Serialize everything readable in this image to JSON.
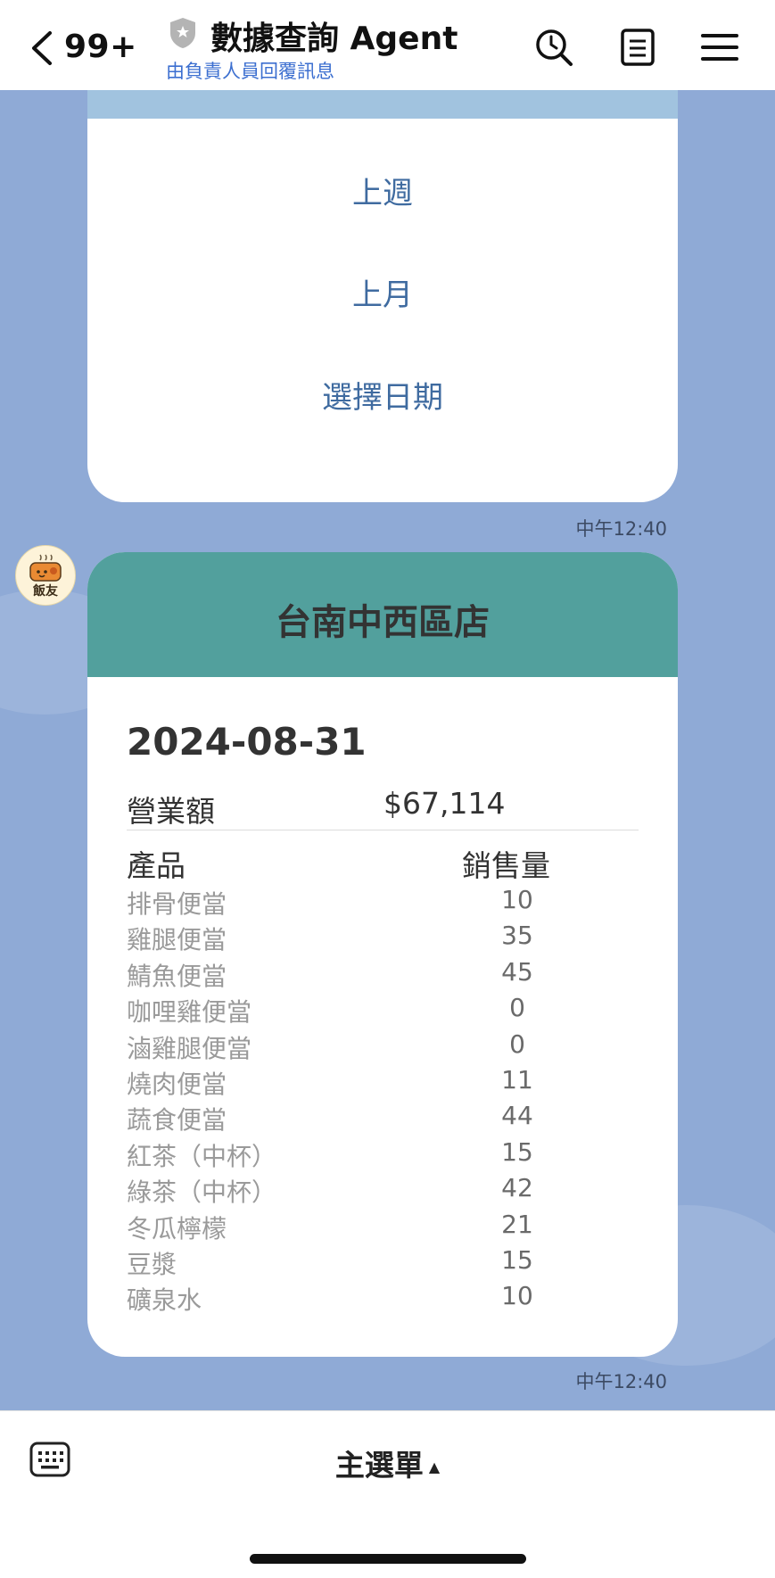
{
  "header": {
    "back_count": "99+",
    "title": "數據查詢 Agent",
    "subtitle": "由負責人員回覆訊息",
    "icons": [
      "back-chevron-icon",
      "shield-icon",
      "search-clock-icon",
      "notes-icon",
      "menu-icon"
    ]
  },
  "messages": {
    "date_options": [
      "上週",
      "上月",
      "選擇日期"
    ],
    "time1": "中午12:40",
    "avatar_label": "飯友",
    "report": {
      "store_name": "台南中西區店",
      "date": "2024-08-31",
      "revenue_label": "營業額",
      "revenue_value": "$67,114",
      "col_product": "產品",
      "col_qty": "銷售量",
      "items": [
        {
          "name": "排骨便當",
          "qty": "10"
        },
        {
          "name": "雞腿便當",
          "qty": "35"
        },
        {
          "name": "鯖魚便當",
          "qty": "45"
        },
        {
          "name": "咖哩雞便當",
          "qty": "0"
        },
        {
          "name": "滷雞腿便當",
          "qty": "0"
        },
        {
          "name": "燒肉便當",
          "qty": "11"
        },
        {
          "name": "蔬食便當",
          "qty": "44"
        },
        {
          "name": "紅茶（中杯）",
          "qty": "15"
        },
        {
          "name": "綠茶（中杯）",
          "qty": "42"
        },
        {
          "name": "冬瓜檸檬",
          "qty": "21"
        },
        {
          "name": "豆漿",
          "qty": "15"
        },
        {
          "name": "礦泉水",
          "qty": "10"
        }
      ]
    },
    "time2": "中午12:40"
  },
  "bottom": {
    "main_menu_label": "主選單",
    "caret": "▲"
  },
  "colors": {
    "chat_bg": "#8faad6",
    "store_header": "#52a09d",
    "option_text": "#3f6ba0",
    "subtitle_text": "#3c6fd0"
  }
}
